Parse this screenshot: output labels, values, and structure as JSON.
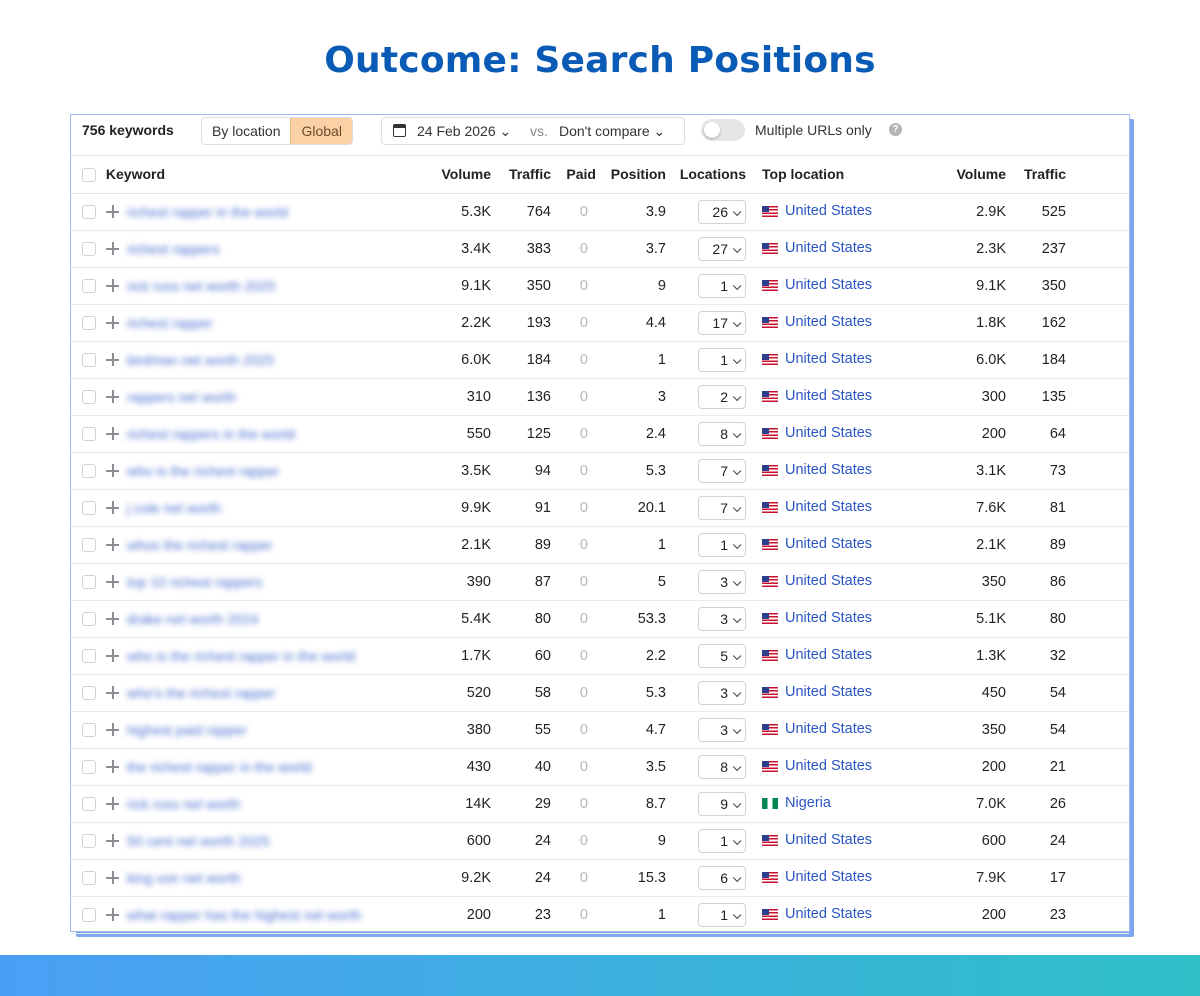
{
  "page": {
    "title": "Outcome: Search Positions"
  },
  "toolbar": {
    "keyword_count": "756 keywords",
    "by_location": "By location",
    "global": "Global",
    "date": "24 Feb 2026",
    "vs": "vs.",
    "compare": "Don't compare",
    "multiple_urls": "Multiple URLs only",
    "help": "?"
  },
  "columns": {
    "keyword": "Keyword",
    "volume": "Volume",
    "traffic": "Traffic",
    "paid": "Paid",
    "position": "Position",
    "locations": "Locations",
    "top_location": "Top location",
    "loc_volume": "Volume",
    "loc_traffic": "Traffic"
  },
  "rows": [
    {
      "keyword": "richest rapper in the world",
      "volume": "5.3K",
      "traffic": "764",
      "paid": "0",
      "position": "3.9",
      "locations": "26",
      "flag": "us",
      "top_location": "United States",
      "loc_volume": "2.9K",
      "loc_traffic": "525"
    },
    {
      "keyword": "richest rappers",
      "volume": "3.4K",
      "traffic": "383",
      "paid": "0",
      "position": "3.7",
      "locations": "27",
      "flag": "us",
      "top_location": "United States",
      "loc_volume": "2.3K",
      "loc_traffic": "237"
    },
    {
      "keyword": "rick ross net worth 2025",
      "volume": "9.1K",
      "traffic": "350",
      "paid": "0",
      "position": "9",
      "locations": "1",
      "flag": "us",
      "top_location": "United States",
      "loc_volume": "9.1K",
      "loc_traffic": "350"
    },
    {
      "keyword": "richest rapper",
      "volume": "2.2K",
      "traffic": "193",
      "paid": "0",
      "position": "4.4",
      "locations": "17",
      "flag": "us",
      "top_location": "United States",
      "loc_volume": "1.8K",
      "loc_traffic": "162"
    },
    {
      "keyword": "birdman net worth 2025",
      "volume": "6.0K",
      "traffic": "184",
      "paid": "0",
      "position": "1",
      "locations": "1",
      "flag": "us",
      "top_location": "United States",
      "loc_volume": "6.0K",
      "loc_traffic": "184"
    },
    {
      "keyword": "rappers net worth",
      "volume": "310",
      "traffic": "136",
      "paid": "0",
      "position": "3",
      "locations": "2",
      "flag": "us",
      "top_location": "United States",
      "loc_volume": "300",
      "loc_traffic": "135"
    },
    {
      "keyword": "richest rappers in the world",
      "volume": "550",
      "traffic": "125",
      "paid": "0",
      "position": "2.4",
      "locations": "8",
      "flag": "us",
      "top_location": "United States",
      "loc_volume": "200",
      "loc_traffic": "64"
    },
    {
      "keyword": "who is the richest rapper",
      "volume": "3.5K",
      "traffic": "94",
      "paid": "0",
      "position": "5.3",
      "locations": "7",
      "flag": "us",
      "top_location": "United States",
      "loc_volume": "3.1K",
      "loc_traffic": "73"
    },
    {
      "keyword": "j cole net worth",
      "volume": "9.9K",
      "traffic": "91",
      "paid": "0",
      "position": "20.1",
      "locations": "7",
      "flag": "us",
      "top_location": "United States",
      "loc_volume": "7.6K",
      "loc_traffic": "81"
    },
    {
      "keyword": "whos the richest rapper",
      "volume": "2.1K",
      "traffic": "89",
      "paid": "0",
      "position": "1",
      "locations": "1",
      "flag": "us",
      "top_location": "United States",
      "loc_volume": "2.1K",
      "loc_traffic": "89"
    },
    {
      "keyword": "top 10 richest rappers",
      "volume": "390",
      "traffic": "87",
      "paid": "0",
      "position": "5",
      "locations": "3",
      "flag": "us",
      "top_location": "United States",
      "loc_volume": "350",
      "loc_traffic": "86"
    },
    {
      "keyword": "drake net worth 2024",
      "volume": "5.4K",
      "traffic": "80",
      "paid": "0",
      "position": "53.3",
      "locations": "3",
      "flag": "us",
      "top_location": "United States",
      "loc_volume": "5.1K",
      "loc_traffic": "80"
    },
    {
      "keyword": "who is the richest rapper in the world",
      "volume": "1.7K",
      "traffic": "60",
      "paid": "0",
      "position": "2.2",
      "locations": "5",
      "flag": "us",
      "top_location": "United States",
      "loc_volume": "1.3K",
      "loc_traffic": "32"
    },
    {
      "keyword": "who's the richest rapper",
      "volume": "520",
      "traffic": "58",
      "paid": "0",
      "position": "5.3",
      "locations": "3",
      "flag": "us",
      "top_location": "United States",
      "loc_volume": "450",
      "loc_traffic": "54"
    },
    {
      "keyword": "highest paid rapper",
      "volume": "380",
      "traffic": "55",
      "paid": "0",
      "position": "4.7",
      "locations": "3",
      "flag": "us",
      "top_location": "United States",
      "loc_volume": "350",
      "loc_traffic": "54"
    },
    {
      "keyword": "the richest rapper in the world",
      "volume": "430",
      "traffic": "40",
      "paid": "0",
      "position": "3.5",
      "locations": "8",
      "flag": "us",
      "top_location": "United States",
      "loc_volume": "200",
      "loc_traffic": "21"
    },
    {
      "keyword": "rick ross net worth",
      "volume": "14K",
      "traffic": "29",
      "paid": "0",
      "position": "8.7",
      "locations": "9",
      "flag": "ng",
      "top_location": "Nigeria",
      "loc_volume": "7.0K",
      "loc_traffic": "26"
    },
    {
      "keyword": "50 cent net worth 2025",
      "volume": "600",
      "traffic": "24",
      "paid": "0",
      "position": "9",
      "locations": "1",
      "flag": "us",
      "top_location": "United States",
      "loc_volume": "600",
      "loc_traffic": "24"
    },
    {
      "keyword": "king von net worth",
      "volume": "9.2K",
      "traffic": "24",
      "paid": "0",
      "position": "15.3",
      "locations": "6",
      "flag": "us",
      "top_location": "United States",
      "loc_volume": "7.9K",
      "loc_traffic": "17"
    },
    {
      "keyword": "what rapper has the highest net worth",
      "volume": "200",
      "traffic": "23",
      "paid": "0",
      "position": "1",
      "locations": "1",
      "flag": "us",
      "top_location": "United States",
      "loc_volume": "200",
      "loc_traffic": "23"
    }
  ]
}
